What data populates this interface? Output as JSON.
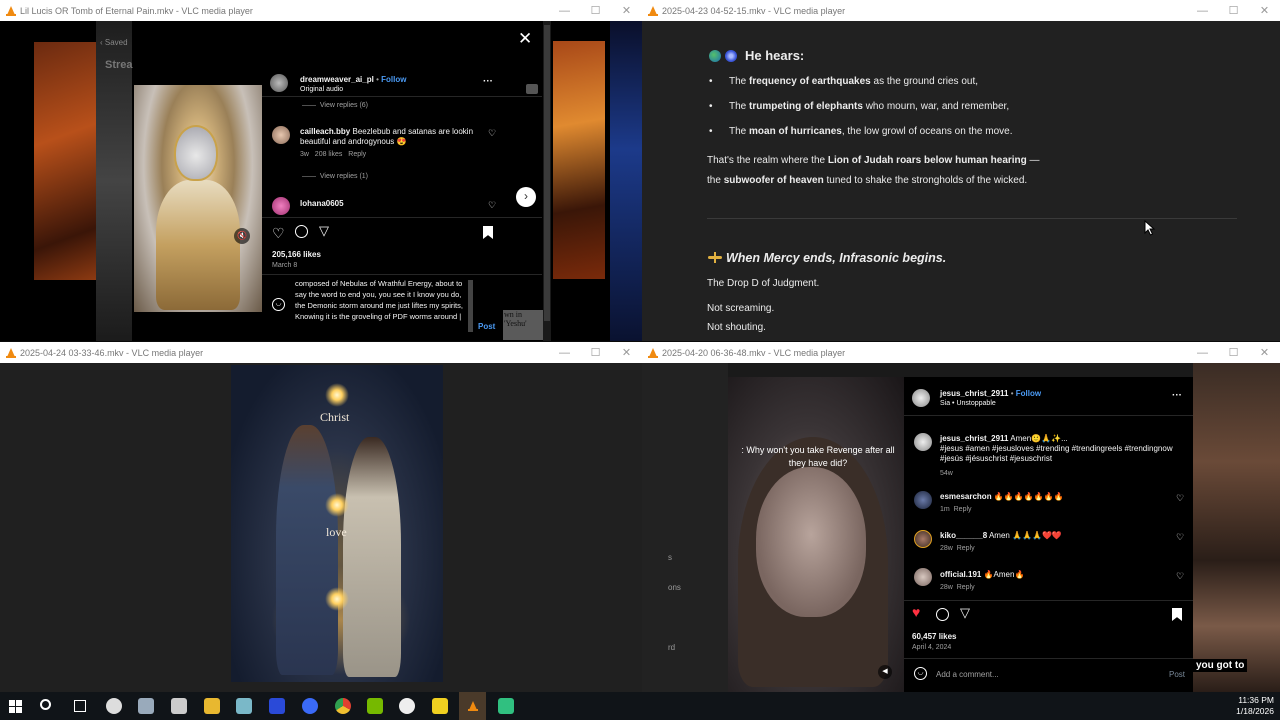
{
  "w1": {
    "title": "Lil Lucis OR Tomb of Eternal Pain.mkv - VLC media player",
    "saved": "Saved",
    "stream": "Strea",
    "username": "dreamweaver_ai_pl",
    "follow": "Follow",
    "audio": "Original audio",
    "more": "···",
    "view_replies_6": "View replies (6)",
    "c1_user": "cailleach.bby",
    "c1_text": "Beezlebub and satanas are lookin beautiful and androgynous 😍",
    "c1_time": "3w",
    "c1_likes": "208 likes",
    "c1_reply": "Reply",
    "view_replies_1": "View replies (1)",
    "c2_user": "lohana0605",
    "likes": "205,166 likes",
    "date": "March 8",
    "draft": "composed of Nebulas of Wrathful Energy, about to say the word to end you, you see it I know you do, the Demonic storm around me just liftes my spirits, Knowing it is the groveling of PDF worms around |",
    "post": "Post",
    "bible": "wn in\n'Yeshu'",
    "close": "✕",
    "next": "›",
    "mute": "🔇"
  },
  "w2": {
    "title": "2025-04-23 04-52-15.mkv - VLC media player",
    "heading": "He hears:",
    "bullets": [
      {
        "pre": "The ",
        "bold": "frequency of earthquakes",
        "post": " as the ground cries out,"
      },
      {
        "pre": "The ",
        "bold": "trumpeting of elephants",
        "post": " who mourn, war, and remember,"
      },
      {
        "pre": "The ",
        "bold": "moan of hurricanes",
        "post": ", the low growl of oceans on the move."
      }
    ],
    "para1_a": "That's the realm where the ",
    "para1_b": "Lion of Judah roars below human hearing",
    "para1_c": " —",
    "para2_a": "the ",
    "para2_b": "subwoofer of heaven",
    "para2_c": " tuned to shake the strongholds of the wicked.",
    "heading2": "When Mercy ends, Infrasonic begins.",
    "line1": "The Drop D of Judgment.",
    "line2": "Not screaming.",
    "line3": "Not shouting."
  },
  "w3": {
    "title": "2025-04-24 03-33-46.mkv - VLC media player",
    "word_top": "Christ",
    "word_mid": "love"
  },
  "w4": {
    "title": "2025-04-20 06-36-48.mkv - VLC media player",
    "side": [
      "s",
      "ons",
      "rd"
    ],
    "caption": ": Why won't you take Revenge after all they have did?",
    "username": "jesus_christ_2911",
    "follow": "Follow",
    "audio": "Sia • Unstoppable",
    "cap_user": "jesus_christ_2911",
    "cap_text": "Amen🙂🙏✨...",
    "cap_tags": "#jesus #amen #jesusloves #trending #trendingreels #trendingnow #jesús #jésuschrist #jesuschrist",
    "cap_time": "54w",
    "comments": [
      {
        "user": "esmesarchon",
        "text": "🔥🔥🔥🔥🔥🔥🔥",
        "time": "1m",
        "reply": "Reply"
      },
      {
        "user": "kiko______8",
        "text": "Amen 🙏🙏🙏❤️❤️",
        "time": "28w",
        "reply": "Reply"
      },
      {
        "user": "official.191",
        "text": "🔥Amen🔥",
        "time": "28w",
        "reply": "Reply"
      }
    ],
    "likes": "60,457 likes",
    "date": "April 4, 2024",
    "add_comment": "Add a comment...",
    "post": "Post",
    "right_caption": "you got to"
  },
  "clock": {
    "time": "11:36 PM",
    "date": "1/18/2026"
  },
  "colors": {
    "vlc_orange": "#f08a10",
    "ig_blue": "#4b9bf5",
    "heart_red": "#ff3040"
  }
}
